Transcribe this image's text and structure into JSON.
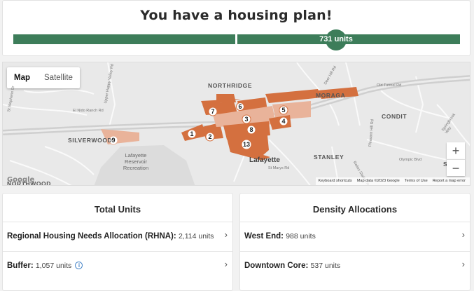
{
  "plan": {
    "title": "You have a housing plan!",
    "total_units_label": "731 units",
    "progress_fraction": 0.73,
    "color_bar": "#3d7d5a"
  },
  "map": {
    "type_control": {
      "map": "Map",
      "satellite": "Satellite"
    },
    "places": {
      "northridge": "NORTHRIDGE",
      "moraga": "MORAGA",
      "condit": "CONDIT",
      "silverwood": "SILVERWOOD",
      "stanley": "STANLEY",
      "lafayette": "Lafayette",
      "reservoir": "Lafayette\nReservoir\nRecreation",
      "norwood": "NORTHWOOD",
      "sa": "SA"
    },
    "roads": {
      "el_nido": "El Nido Ranch Rd",
      "upper_happy": "Upper Happy Valley Rd",
      "old_tunnel": "Old Tunnel Rd",
      "pleasant_hill": "Pleasant Hill Rd",
      "olympic": "Olympic Blvd",
      "st_marys": "St Marys Rd",
      "reliez": "Reliez Station Rd",
      "deer_hill": "Deer Hill Rd",
      "springbrook": "Springbrook Way",
      "st_stephens": "St Stephens Dr"
    },
    "zones": [
      "1",
      "2",
      "3",
      "4",
      "5",
      "6",
      "7",
      "8",
      "9",
      "13"
    ],
    "zoom_in": "+",
    "zoom_out": "−",
    "attribution": {
      "shortcuts": "Keyboard shortcuts",
      "data": "Map data ©2023 Google",
      "terms": "Terms of Use",
      "report": "Report a map error"
    },
    "google": "Google",
    "colors": {
      "zone_dark": "#d4703f",
      "zone_light": "#e9b39a",
      "freeway": "#cfcfcf"
    }
  },
  "total_units": {
    "title": "Total Units",
    "rows": [
      {
        "label": "Regional Housing Needs Allocation (RHNA):",
        "value": "2,114 units"
      },
      {
        "label": "Buffer:",
        "value": "1,057 units",
        "info": "i"
      }
    ]
  },
  "density": {
    "title": "Density Allocations",
    "rows": [
      {
        "label": "West End:",
        "value": "988 units"
      },
      {
        "label": "Downtown Core:",
        "value": "537 units"
      }
    ]
  },
  "chevron": "›"
}
